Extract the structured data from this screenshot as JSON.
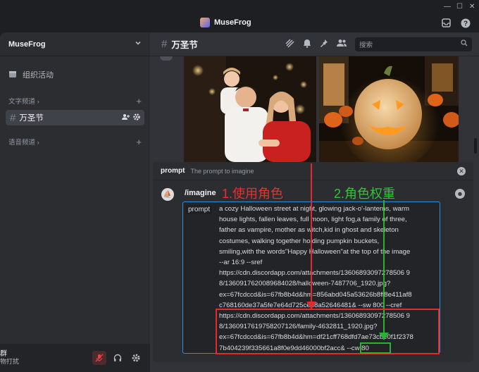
{
  "window": {
    "app_title": "MuseFrog",
    "min": "—",
    "max": "☐",
    "close": "✕"
  },
  "sidebar": {
    "server_name": "MuseFrog",
    "events_label": "组织活动",
    "text_category": "文字频道",
    "active_channel": "万圣节",
    "voice_category": "语音频道",
    "user": {
      "name": "群",
      "status": "物打扰"
    }
  },
  "header": {
    "channel": "万圣节",
    "search_placeholder": "搜索"
  },
  "command": {
    "name": "prompt",
    "description": "The prompt to imagine",
    "slash": "/imagine",
    "option": "prompt"
  },
  "prompt_text": "a cozy Halloween street at night, glowing jack-o'-lanterns, warm\nhouse lights, fallen leaves, full moon, light fog,a family of three,\nfather as vampire, mother as witch,kid in ghost and skeleton\ncostumes, walking together holding pumpkin buckets,\nsmiling,with the words\"Happy Halloween\"at the top of the image\n--ar 16:9 --sref\nhttps://cdn.discordapp.com/attachments/13606893097278506 9\n8/1360917620089684028/halloween-7487706_1920.jpg?\nex=67fcdccd&is=67fb8b4d&hm=856abd045a53626b8ff8e411af8\nc768160de37a5fe7e64d725ceb8a52646481& --sw 800 --cref\nhttps://cdn.discordapp.com/attachments/13606893097278506 9\n8/1360917619758207126/family-4632811_1920.jpg?\nex=67fcdccd&is=67fb8b4d&hm=df21cff768dfd7ae73cbe0f1f2378\n7b404239f335661a8f0e9dd46000bf2acc& --cw 80",
  "annotations": {
    "label1": "1.使用角色",
    "label2": "2.角色权重"
  },
  "colors": {
    "red": "#e32b2b",
    "green": "#2ab332",
    "blurple": "#2f8fd8"
  }
}
